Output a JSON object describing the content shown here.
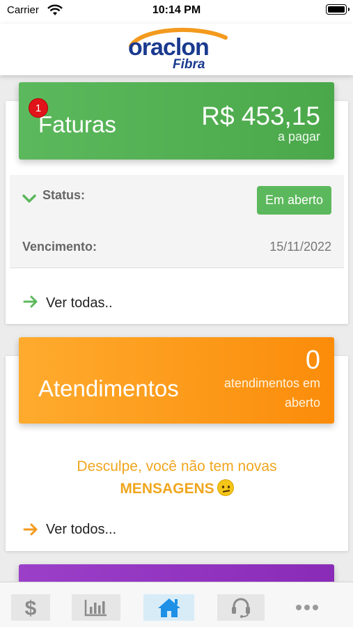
{
  "status_bar": {
    "carrier": "Carrier",
    "time": "10:14 PM"
  },
  "header": {
    "logo_text_main": "oraclon",
    "logo_text_sub": "Fibra"
  },
  "faturas": {
    "badge_count": "1",
    "title": "Faturas",
    "amount": "R$ 453,15",
    "amount_caption": "a pagar",
    "status_label": "Status:",
    "status_value": "Em aberto",
    "due_label": "Vencimento:",
    "due_date": "15/11/2022",
    "link": "Ver todas.."
  },
  "atendimentos": {
    "title": "Atendimentos",
    "count": "0",
    "count_caption": "atendimentos em aberto",
    "message_line1": "Desculpe, você não tem novas",
    "message_line2": "MENSAGENS",
    "link": "Ver todos..."
  },
  "tabbar": {
    "items": [
      {
        "icon": "dollar-icon",
        "active": false
      },
      {
        "icon": "bar-chart-icon",
        "active": false
      },
      {
        "icon": "home-icon",
        "active": true
      },
      {
        "icon": "headset-icon",
        "active": false
      },
      {
        "icon": "more-icon",
        "active": false
      }
    ]
  },
  "colors": {
    "green": "#5cb85c",
    "orange": "#fb8c0a",
    "purple": "#8a2bb7",
    "badge_red": "#e0141a",
    "logo_blue": "#1a3a8f",
    "logo_orange": "#f39a1e"
  }
}
